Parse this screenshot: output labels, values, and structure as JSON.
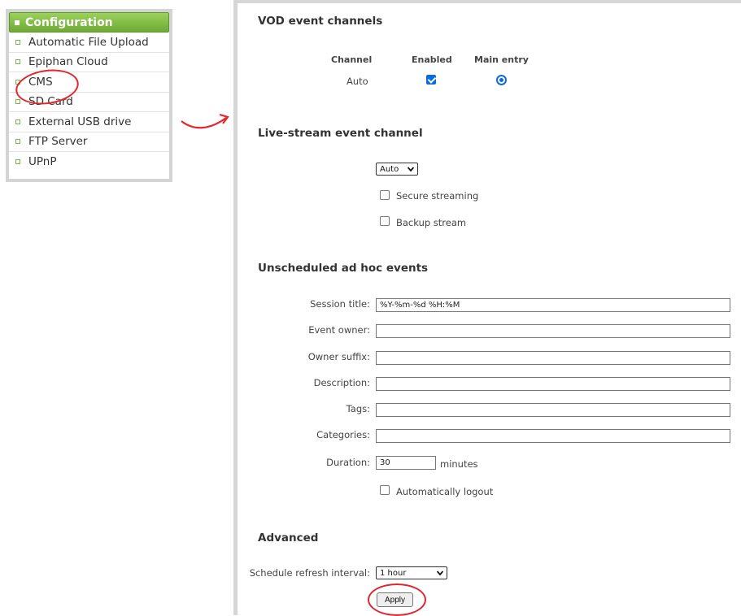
{
  "sidebar": {
    "header": "Configuration",
    "items": [
      {
        "label": "Automatic File Upload"
      },
      {
        "label": "Epiphan Cloud"
      },
      {
        "label": "CMS"
      },
      {
        "label": "SD Card"
      },
      {
        "label": "External USB drive"
      },
      {
        "label": "FTP Server"
      },
      {
        "label": "UPnP"
      }
    ],
    "highlighted": "CMS"
  },
  "vod": {
    "title": "VOD event channels",
    "col_channel": "Channel",
    "col_enabled": "Enabled",
    "col_main_entry": "Main entry",
    "row_channel": "Auto",
    "row_enabled": true,
    "row_main_entry": true
  },
  "live": {
    "title": "Live-stream event channel",
    "channel_select": "Auto",
    "secure_streaming_label": "Secure streaming",
    "secure_streaming": false,
    "backup_stream_label": "Backup stream",
    "backup_stream": false
  },
  "adhoc": {
    "title": "Unscheduled ad hoc events",
    "session_title_label": "Session title:",
    "session_title_value": "%Y-%m-%d %H:%M",
    "event_owner_label": "Event owner:",
    "event_owner_value": "",
    "owner_suffix_label": "Owner suffix:",
    "owner_suffix_value": "",
    "description_label": "Description:",
    "description_value": "",
    "tags_label": "Tags:",
    "tags_value": "",
    "categories_label": "Categories:",
    "categories_value": "",
    "duration_label": "Duration:",
    "duration_value": "30",
    "duration_unit": "minutes",
    "auto_logout_label": "Automatically logout",
    "auto_logout": false
  },
  "advanced": {
    "title": "Advanced",
    "refresh_label": "Schedule refresh interval:",
    "refresh_value": "1 hour",
    "apply_label": "Apply"
  },
  "colors": {
    "accent_green": "#6da935",
    "checkbox_blue": "#0b6cd9",
    "annotation_red": "#e2262b"
  }
}
